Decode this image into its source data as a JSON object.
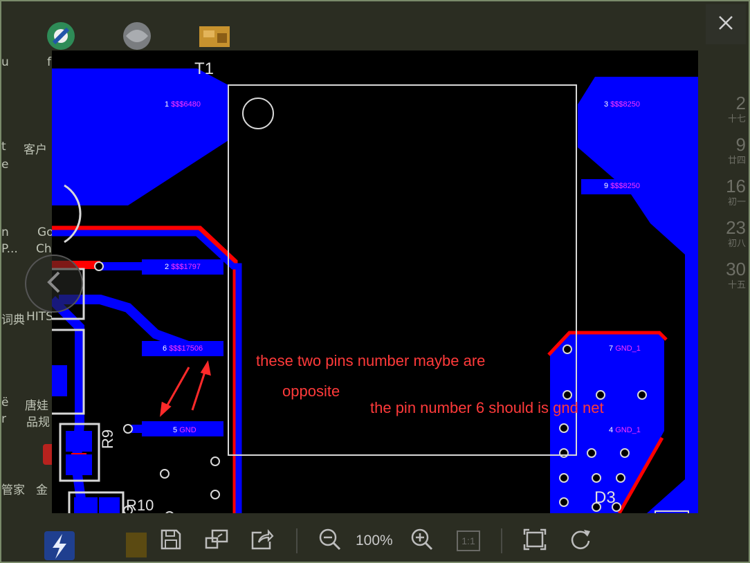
{
  "desktop": {
    "left_labels": [
      "u",
      "f",
      "t",
      "e",
      "n",
      "P...",
      "ë",
      "r",
      "管家"
    ],
    "texts": [
      "客户",
      "Go",
      "Chi",
      "词典",
      "HITS",
      "唐娃",
      "品规",
      "金"
    ],
    "calendar": [
      {
        "day": "2",
        "sub": "十七"
      },
      {
        "day": "9",
        "sub": "廿四"
      },
      {
        "day": "16",
        "sub": "初一"
      },
      {
        "day": "23",
        "sub": "初八"
      },
      {
        "day": "30",
        "sub": "十五"
      }
    ]
  },
  "viewer": {
    "component_label": "T1",
    "pins": [
      {
        "label": "1 ",
        "net": "$$$6480"
      },
      {
        "label": "2 ",
        "net": "$$$1797"
      },
      {
        "label": "6 ",
        "net": "$$$17506"
      },
      {
        "label": "5 ",
        "net": "GND"
      },
      {
        "label": "3 ",
        "net": "$$$8250"
      },
      {
        "label": "9 ",
        "net": "$$$8250"
      },
      {
        "label": "7 ",
        "net": "GND_1"
      },
      {
        "label": "4 ",
        "net": "GND_1"
      }
    ],
    "refdes": {
      "r9": "R9",
      "r10": "R10",
      "d3": "D3"
    },
    "annotations": {
      "line1": "these two pins number maybe are",
      "line2": "opposite",
      "line3": "the pin number 6 should is gnd net"
    },
    "colors": {
      "copper": "#0000ff",
      "trace_red": "#ff0000",
      "silk": "#d8d8d8",
      "annotation": "#ff3030",
      "pad_text": "#ff33ff"
    }
  },
  "toolbar": {
    "zoom_label": "100%",
    "one_to_one_label": "1:1",
    "buttons": [
      "save-icon",
      "open-window-icon",
      "share-icon",
      "zoom-out-icon",
      "zoom-in-icon",
      "actual-size-icon",
      "fit-screen-icon",
      "rotate-icon"
    ]
  }
}
